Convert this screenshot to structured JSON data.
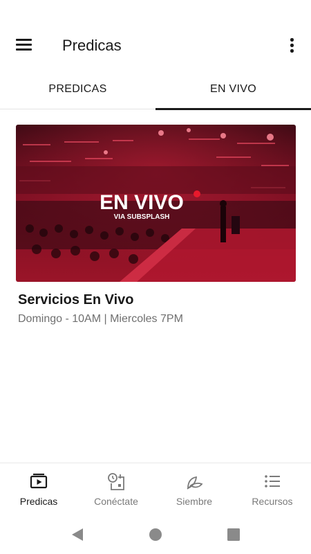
{
  "app_bar": {
    "title": "Predicas",
    "menu_icon": "hamburger-menu-icon",
    "more_icon": "more-vertical-icon"
  },
  "tabs": [
    {
      "label": "PREDICAS",
      "selected": false
    },
    {
      "label": "EN VIVO",
      "selected": true
    }
  ],
  "card": {
    "thumbnail": {
      "headline": "EN VIVO",
      "subline": "VIA SUBSPLASH"
    },
    "title": "Servicios En Vivo",
    "subtitle": "Domingo - 10AM | Miercoles 7PM"
  },
  "bottom_nav": [
    {
      "label": "Predicas",
      "icon": "video-library-icon",
      "active": true
    },
    {
      "label": "Conéctate",
      "icon": "calendar-clock-icon",
      "active": false
    },
    {
      "label": "Siembre",
      "icon": "seedling-icon",
      "active": false
    },
    {
      "label": "Recursos",
      "icon": "list-icon",
      "active": false
    }
  ],
  "system_nav": {
    "back_icon": "back-triangle-icon",
    "home_icon": "home-circle-icon",
    "recents_icon": "recents-square-icon"
  },
  "colors": {
    "text": "#1a1a1a",
    "muted": "#6f6f6f",
    "thumbnail_red": "#8e1226",
    "live_dot": "#e8192c"
  }
}
